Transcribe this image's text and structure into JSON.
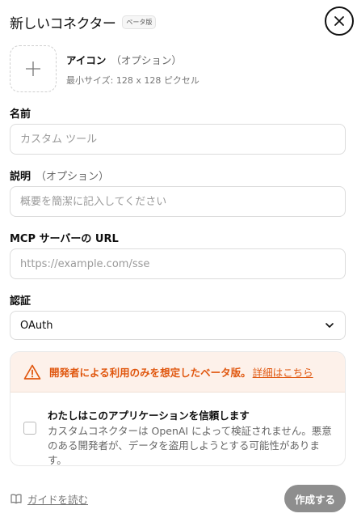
{
  "header": {
    "title": "新しいコネクター",
    "beta_badge": "ベータ版"
  },
  "icon_section": {
    "label": "アイコン",
    "optional": "（オプション）",
    "hint": "最小サイズ: 128 x 128 ピクセル"
  },
  "name_field": {
    "label": "名前",
    "placeholder": "カスタム ツール"
  },
  "description_field": {
    "label": "説明",
    "optional": "（オプション）",
    "placeholder": "概要を簡潔に記入してください"
  },
  "url_field": {
    "label": "MCP サーバーの URL",
    "placeholder": "https://example.com/sse"
  },
  "auth_field": {
    "label": "認証",
    "selected": "OAuth"
  },
  "warning": {
    "text": "開発者による利用のみを想定したベータ版。",
    "link": "詳細はこちら",
    "trust_title": "わたしはこのアプリケーションを信頼します",
    "trust_desc": "カスタムコネクターは OpenAI によって検証されません。悪意のある開発者が、データを盗用しようとする可能性があります。",
    "accent_color": "#e0570f"
  },
  "footer": {
    "guide_label": "ガイドを読む",
    "create_label": "作成する"
  }
}
